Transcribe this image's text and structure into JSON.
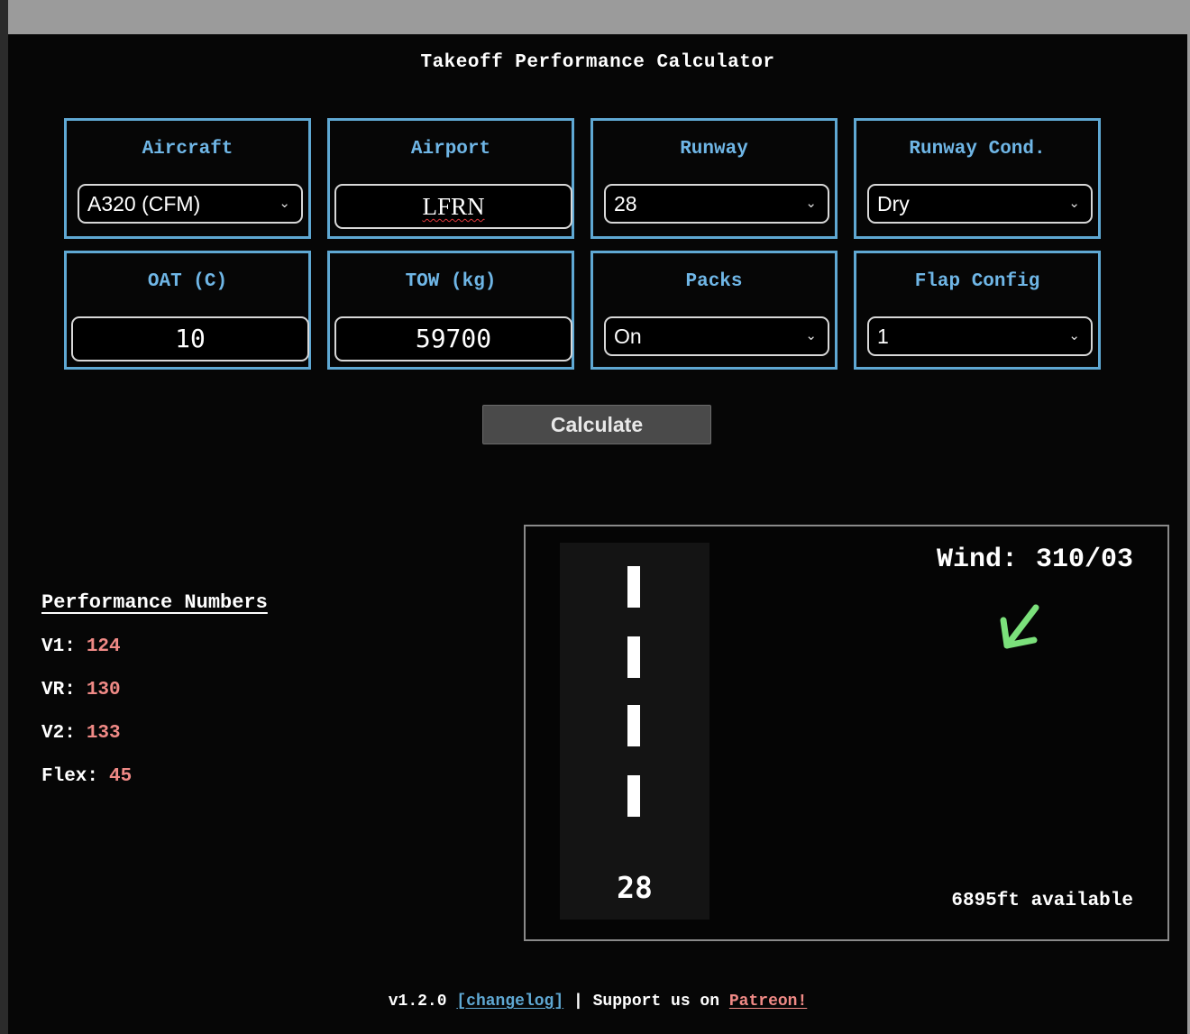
{
  "title": "Takeoff Performance Calculator",
  "colors": {
    "accent_blue": "#5fa8d3",
    "value_pink": "#f08a86",
    "wind_arrow": "#7be07b"
  },
  "cards": {
    "aircraft": {
      "label": "Aircraft",
      "value": "A320 (CFM)"
    },
    "airport": {
      "label": "Airport",
      "value": "LFRN"
    },
    "runway": {
      "label": "Runway",
      "value": "28"
    },
    "runway_cond": {
      "label": "Runway Cond.",
      "value": "Dry"
    },
    "oat": {
      "label": "OAT (C)",
      "value": "10"
    },
    "tow": {
      "label": "TOW (kg)",
      "value": "59700"
    },
    "packs": {
      "label": "Packs",
      "value": "On"
    },
    "flap": {
      "label": "Flap Config",
      "value": "1"
    }
  },
  "calculate_label": "Calculate",
  "perf": {
    "heading": "Performance Numbers",
    "v1_label": "V1:",
    "v1": "124",
    "vr_label": "VR:",
    "vr": "130",
    "v2_label": "V2:",
    "v2": "133",
    "flex_label": "Flex:",
    "flex": "45"
  },
  "runway_panel": {
    "runway_number": "28",
    "wind_label": "Wind:",
    "wind_value": "310/03",
    "available": "6895ft available",
    "wind_icon": "arrow-down-left-icon"
  },
  "footer": {
    "version": "v1.2.0",
    "changelog": "[changelog]",
    "separator": "|",
    "support_text": "Support us on",
    "patreon": "Patreon!"
  }
}
